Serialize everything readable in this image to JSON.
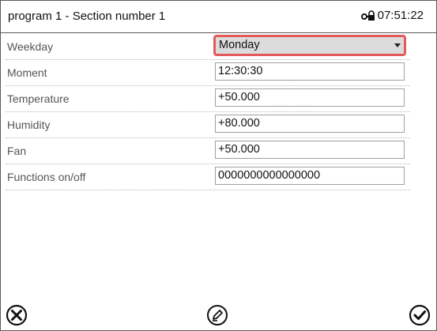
{
  "header": {
    "title": "program 1 - Section number 1",
    "time": "07:51:22",
    "lock_icon": "key-lock-icon"
  },
  "fields": [
    {
      "label": "Weekday",
      "value": "Monday",
      "type": "select"
    },
    {
      "label": "Moment",
      "value": "12:30:30",
      "type": "input"
    },
    {
      "label": "Temperature",
      "value": "+50.000",
      "type": "input"
    },
    {
      "label": "Humidity",
      "value": "+80.000",
      "type": "input"
    },
    {
      "label": "Fan",
      "value": "+50.000",
      "type": "input"
    },
    {
      "label": "Functions on/off",
      "value": "0000000000000000",
      "type": "input"
    }
  ],
  "footer": {
    "cancel_icon": "close-circle-icon",
    "edit_icon": "pencil-circle-icon",
    "confirm_icon": "check-circle-icon"
  },
  "colors": {
    "focus_border": "#e25a5a",
    "select_bg": "#dcdcdc"
  }
}
